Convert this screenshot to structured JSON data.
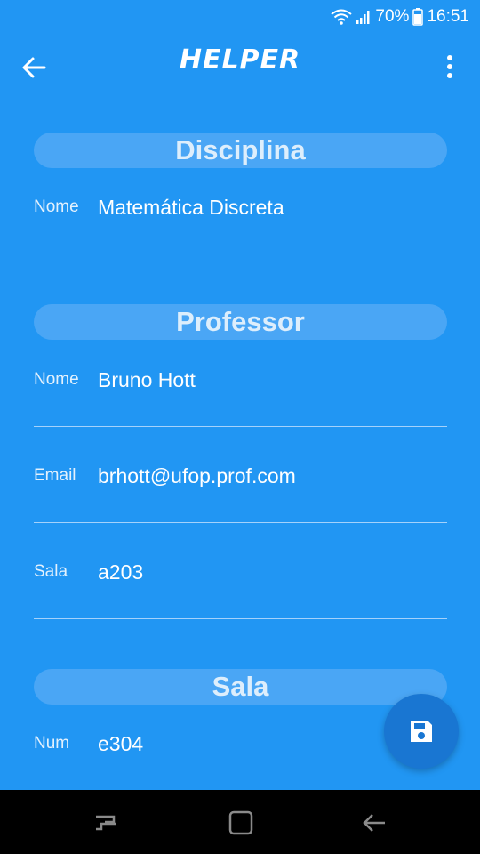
{
  "status": {
    "battery": "70%",
    "time": "16:51"
  },
  "app_bar": {
    "title": "HELPER"
  },
  "sections": [
    {
      "header": "Disciplina",
      "fields": [
        {
          "label": "Nome",
          "value": "Matemática Discreta"
        }
      ]
    },
    {
      "header": "Professor",
      "fields": [
        {
          "label": "Nome",
          "value": "Bruno Hott"
        },
        {
          "label": "Email",
          "value": "brhott@ufop.prof.com"
        },
        {
          "label": "Sala",
          "value": "a203"
        }
      ]
    },
    {
      "header": "Sala",
      "fields": [
        {
          "label": "Num",
          "value": "e304"
        }
      ]
    }
  ],
  "icons": {
    "back": "arrow-left-icon",
    "menu": "more-vert-icon",
    "fab": "save-icon",
    "nav": [
      "recents-icon",
      "home-icon",
      "nav-back-icon"
    ]
  },
  "colors": {
    "background": "#2196F3",
    "pill": "#4AA6F5",
    "fab": "#1976D2",
    "nav": "#000000"
  }
}
